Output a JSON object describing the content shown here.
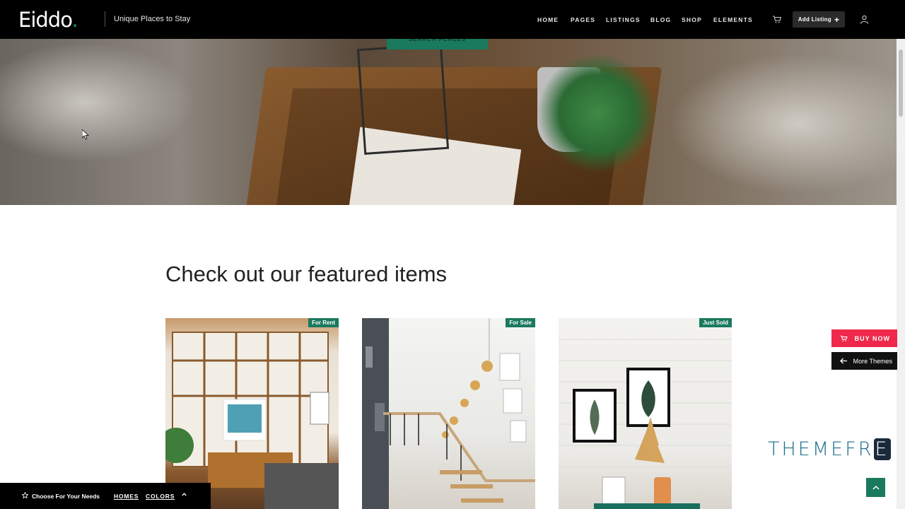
{
  "header": {
    "logo": "Eiddo",
    "logo_dot": ".",
    "tagline": "Unique Places to Stay",
    "nav": [
      "HOME",
      "PAGES",
      "LISTINGS",
      "BLOG",
      "SHOP",
      "ELEMENTS"
    ],
    "add_listing_label": "Add Listing",
    "cart_icon": "cart-icon",
    "user_icon": "user-icon"
  },
  "hero": {
    "search_button_label": "SEARCH PLACES"
  },
  "main": {
    "section_title": "Check out our featured items",
    "cards": [
      {
        "badge": "For Rent"
      },
      {
        "badge": "For Sale"
      },
      {
        "badge": "Just Sold"
      }
    ]
  },
  "widgets": {
    "buy_now_label": "BUY NOW",
    "more_themes_label": "More Themes",
    "brand_text": "THEMEFR",
    "brand_e": "E"
  },
  "bottom_bar": {
    "choose_label": "Choose For Your Needs",
    "homes_label": "HOMES",
    "colors_label": "COLORS"
  },
  "colors": {
    "accent": "#1a7a5e",
    "buy_now": "#f0284b",
    "header_bg": "#000000"
  }
}
